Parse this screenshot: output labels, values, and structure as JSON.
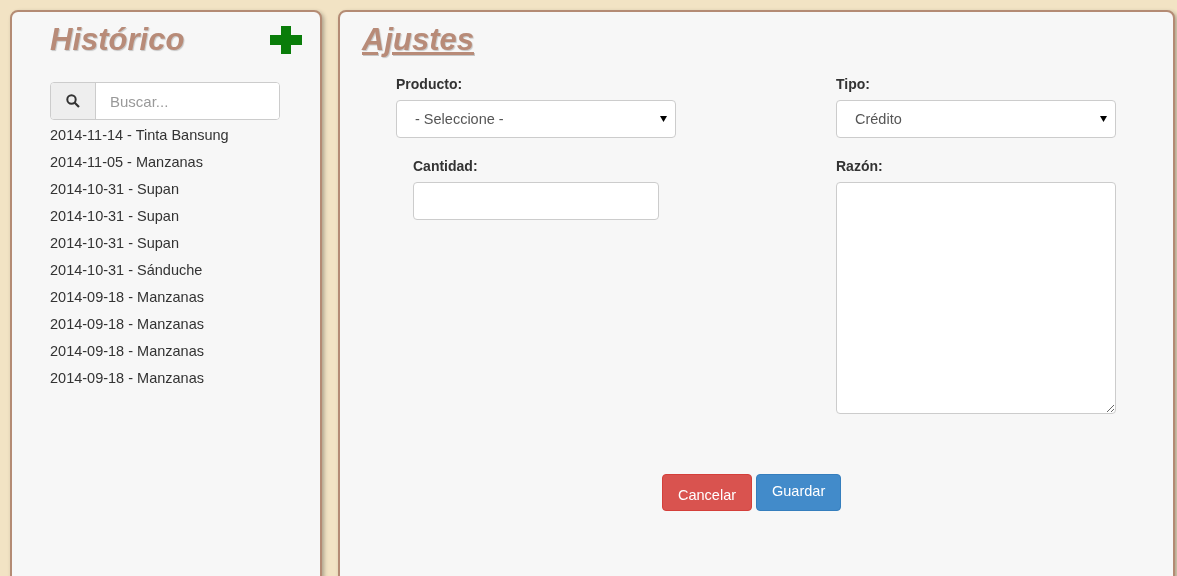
{
  "history": {
    "title": "Histórico",
    "search": {
      "placeholder": "Buscar..."
    },
    "items": [
      "2014-11-14 - Tinta Bansung",
      "2014-11-05 - Manzanas",
      "2014-10-31 - Supan",
      "2014-10-31 - Supan",
      "2014-10-31 - Supan",
      "2014-10-31 - Sánduche",
      "2014-09-18 - Manzanas",
      "2014-09-18 - Manzanas",
      "2014-09-18 - Manzanas",
      "2014-09-18 - Manzanas"
    ]
  },
  "form": {
    "title": "Ajustes",
    "producto": {
      "label": "Producto:",
      "value": "- Seleccione -"
    },
    "tipo": {
      "label": "Tipo:",
      "value": "Crédito"
    },
    "cantidad": {
      "label": "Cantidad:"
    },
    "razon": {
      "label": "Razón:"
    },
    "buttons": [
      {
        "label": "Cancelar",
        "kind": "danger"
      },
      {
        "label": "Guardar",
        "kind": "primary"
      }
    ]
  }
}
